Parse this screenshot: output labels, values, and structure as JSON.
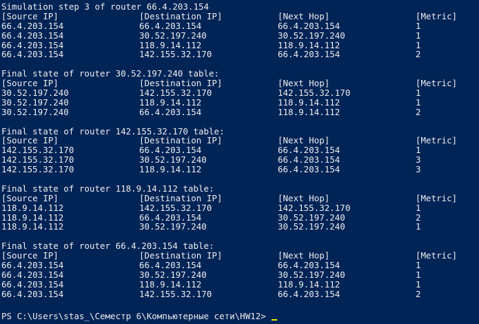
{
  "colors": {
    "background": "#012456",
    "text": "#eeedf0",
    "cursor": "#f3f200"
  },
  "header": "Simulation step 3 of router 66.4.203.154",
  "columns": [
    "[Source IP]",
    "[Destination IP]",
    "[Next Hop]",
    "[Metric]"
  ],
  "sections": [
    {
      "title": "",
      "rows": [
        [
          "66.4.203.154",
          "66.4.203.154",
          "66.4.203.154",
          "1"
        ],
        [
          "66.4.203.154",
          "30.52.197.240",
          "30.52.197.240",
          "1"
        ],
        [
          "66.4.203.154",
          "118.9.14.112",
          "118.9.14.112",
          "1"
        ],
        [
          "66.4.203.154",
          "142.155.32.170",
          "66.4.203.154",
          "2"
        ]
      ]
    },
    {
      "title": "Final state of router 30.52.197.240 table:",
      "rows": [
        [
          "30.52.197.240",
          "142.155.32.170",
          "142.155.32.170",
          "1"
        ],
        [
          "30.52.197.240",
          "118.9.14.112",
          "118.9.14.112",
          "1"
        ],
        [
          "30.52.197.240",
          "66.4.203.154",
          "118.9.14.112",
          "2"
        ]
      ]
    },
    {
      "title": "Final state of router 142.155.32.170 table:",
      "rows": [
        [
          "142.155.32.170",
          "66.4.203.154",
          "66.4.203.154",
          "1"
        ],
        [
          "142.155.32.170",
          "30.52.197.240",
          "66.4.203.154",
          "3"
        ],
        [
          "142.155.32.170",
          "118.9.14.112",
          "66.4.203.154",
          "3"
        ]
      ]
    },
    {
      "title": "Final state of router 118.9.14.112 table:",
      "rows": [
        [
          "118.9.14.112",
          "142.155.32.170",
          "142.155.32.170",
          "1"
        ],
        [
          "118.9.14.112",
          "66.4.203.154",
          "30.52.197.240",
          "2"
        ],
        [
          "118.9.14.112",
          "30.52.197.240",
          "30.52.197.240",
          "1"
        ]
      ]
    },
    {
      "title": "Final state of router 66.4.203.154 table:",
      "rows": [
        [
          "66.4.203.154",
          "66.4.203.154",
          "66.4.203.154",
          "1"
        ],
        [
          "66.4.203.154",
          "30.52.197.240",
          "30.52.197.240",
          "1"
        ],
        [
          "66.4.203.154",
          "118.9.14.112",
          "118.9.14.112",
          "1"
        ],
        [
          "66.4.203.154",
          "142.155.32.170",
          "66.4.203.154",
          "2"
        ]
      ]
    }
  ],
  "prompt": "PS C:\\Users\\stas_\\Семестр 6\\Компьютерные сети\\HW12>"
}
